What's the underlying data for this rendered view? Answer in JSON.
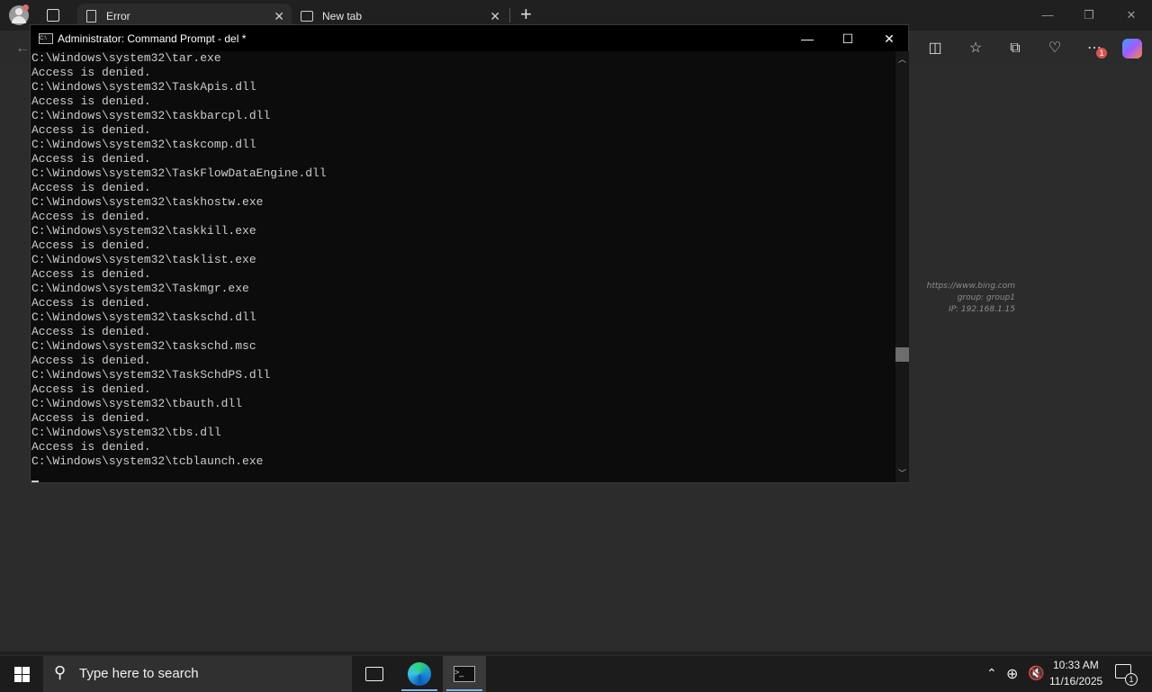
{
  "browser": {
    "tabs": [
      {
        "title": "Error",
        "active": true
      },
      {
        "title": "New tab",
        "active": false
      }
    ],
    "new_tab_glyph": "+"
  },
  "watermark": {
    "line1": "https://www.bing.com",
    "line2": "group: group1",
    "line3": "IP: 192.168.1.15"
  },
  "cmd": {
    "title": "Administrator: Command Prompt - del  *",
    "lines": [
      "C:\\Windows\\system32\\tar.exe",
      "Access is denied.",
      "C:\\Windows\\system32\\TaskApis.dll",
      "Access is denied.",
      "C:\\Windows\\system32\\taskbarcpl.dll",
      "Access is denied.",
      "C:\\Windows\\system32\\taskcomp.dll",
      "Access is denied.",
      "C:\\Windows\\system32\\TaskFlowDataEngine.dll",
      "Access is denied.",
      "C:\\Windows\\system32\\taskhostw.exe",
      "Access is denied.",
      "C:\\Windows\\system32\\taskkill.exe",
      "Access is denied.",
      "C:\\Windows\\system32\\tasklist.exe",
      "Access is denied.",
      "C:\\Windows\\system32\\Taskmgr.exe",
      "Access is denied.",
      "C:\\Windows\\system32\\taskschd.dll",
      "Access is denied.",
      "C:\\Windows\\system32\\taskschd.msc",
      "Access is denied.",
      "C:\\Windows\\system32\\TaskSchdPS.dll",
      "Access is denied.",
      "C:\\Windows\\system32\\tbauth.dll",
      "Access is denied.",
      "C:\\Windows\\system32\\tbs.dll",
      "Access is denied.",
      "C:\\Windows\\system32\\tcblaunch.exe"
    ],
    "scroll_position": 0.72
  },
  "taskbar": {
    "search_placeholder": "Type here to search",
    "time": "10:33 AM",
    "date": "11/16/2025",
    "notification_count": "1"
  },
  "toolbar": {
    "menu_badge": "1"
  }
}
